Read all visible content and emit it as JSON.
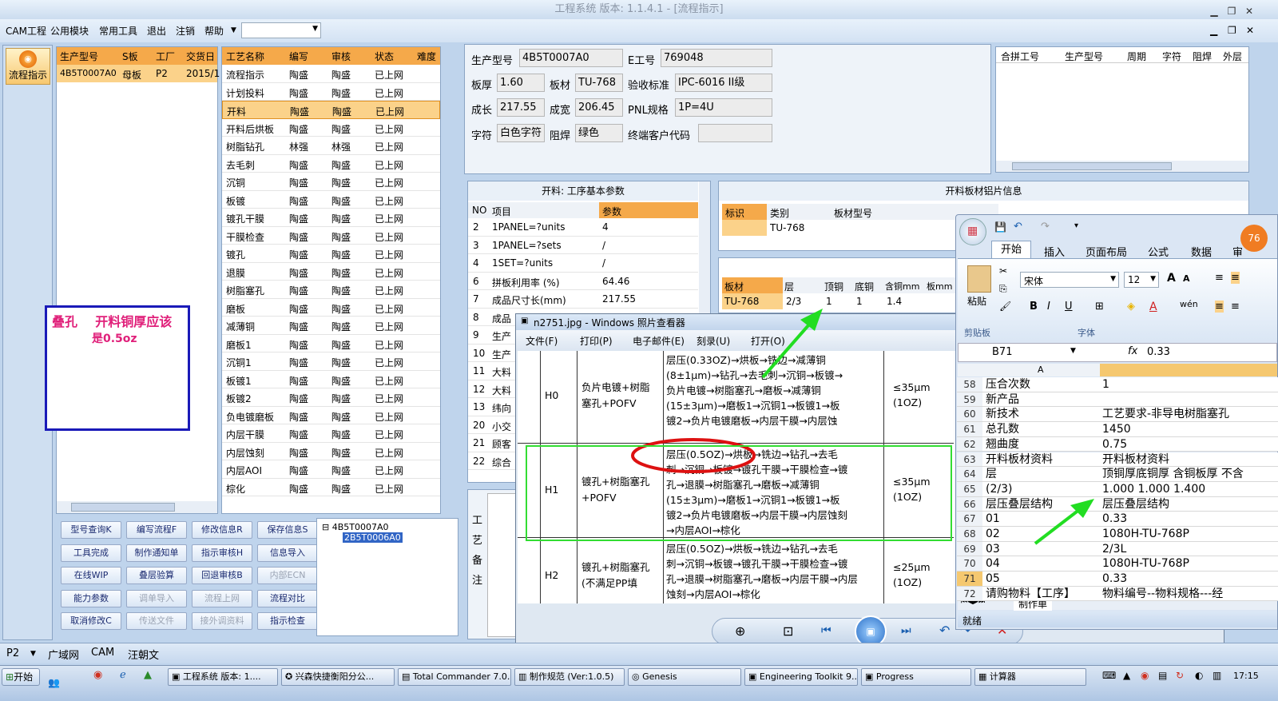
{
  "window": {
    "title": "工程系统  版本: 1.1.4.1 - [流程指示]"
  },
  "menu": {
    "items": [
      "CAM工程",
      "公用模块",
      "常用工具",
      "退出",
      "注销",
      "帮助"
    ]
  },
  "left_nav": {
    "label": "流程指示"
  },
  "job_table": {
    "headers": [
      "生产型号",
      "S板",
      "工厂",
      "交货日"
    ],
    "rows": [
      [
        "4B5T0007A0",
        "母板",
        "P2",
        "2015/1"
      ]
    ]
  },
  "note": {
    "line1": "叠孔    开料铜厚应该",
    "line2": "是0.5oz"
  },
  "process_table": {
    "headers": [
      "工艺名称",
      "编写",
      "审核",
      "状态",
      "难度"
    ],
    "rows": [
      [
        "流程指示",
        "陶盛",
        "陶盛",
        "已上网"
      ],
      [
        "计划投料",
        "陶盛",
        "陶盛",
        "已上网"
      ],
      [
        "开料",
        "陶盛",
        "陶盛",
        "已上网"
      ],
      [
        "开料后烘板",
        "陶盛",
        "陶盛",
        "已上网"
      ],
      [
        "树脂钻孔",
        "林强",
        "林强",
        "已上网"
      ],
      [
        "去毛刺",
        "陶盛",
        "陶盛",
        "已上网"
      ],
      [
        "沉铜",
        "陶盛",
        "陶盛",
        "已上网"
      ],
      [
        "板镀",
        "陶盛",
        "陶盛",
        "已上网"
      ],
      [
        "镀孔干膜",
        "陶盛",
        "陶盛",
        "已上网"
      ],
      [
        "干膜检查",
        "陶盛",
        "陶盛",
        "已上网"
      ],
      [
        "镀孔",
        "陶盛",
        "陶盛",
        "已上网"
      ],
      [
        "退膜",
        "陶盛",
        "陶盛",
        "已上网"
      ],
      [
        "树脂塞孔",
        "陶盛",
        "陶盛",
        "已上网"
      ],
      [
        "磨板",
        "陶盛",
        "陶盛",
        "已上网"
      ],
      [
        "减薄铜",
        "陶盛",
        "陶盛",
        "已上网"
      ],
      [
        "磨板1",
        "陶盛",
        "陶盛",
        "已上网"
      ],
      [
        "沉铜1",
        "陶盛",
        "陶盛",
        "已上网"
      ],
      [
        "板镀1",
        "陶盛",
        "陶盛",
        "已上网"
      ],
      [
        "板镀2",
        "陶盛",
        "陶盛",
        "已上网"
      ],
      [
        "负电镀磨板",
        "陶盛",
        "陶盛",
        "已上网"
      ],
      [
        "内层干膜",
        "陶盛",
        "陶盛",
        "已上网"
      ],
      [
        "内层蚀刻",
        "陶盛",
        "陶盛",
        "已上网"
      ],
      [
        "内层AOI",
        "陶盛",
        "陶盛",
        "已上网"
      ],
      [
        "棕化",
        "陶盛",
        "陶盛",
        "已上网"
      ]
    ]
  },
  "buttons": [
    [
      "型号查询K",
      "编写流程F",
      "修改信息R",
      "保存信息S"
    ],
    [
      "工具完成",
      "制作通知单",
      "指示审核H",
      "信息导入"
    ],
    [
      "在线WIP",
      "叠层验算",
      "回退审核B",
      "内部ECN"
    ],
    [
      "能力参数",
      "调单导入",
      "流程上网",
      "流程对比"
    ],
    [
      "取消修改C",
      "传送文件",
      "接外调资料",
      "指示检查"
    ]
  ],
  "tree": {
    "root": "4B5T0007A0",
    "child": "2B5T0006A0"
  },
  "info": {
    "model_label": "生产型号",
    "model": "4B5T0007A0",
    "e_label": "E工号",
    "e_no": "769048",
    "thick_label": "板厚",
    "thick": "1.60",
    "mat_label": "板材",
    "mat": "TU-768",
    "std_label": "验收标准",
    "std": "IPC-6016 II级",
    "len_label": "成长",
    "len": "217.55",
    "wid_label": "成宽",
    "wid": "206.45",
    "pnl_label": "PNL规格",
    "pnl": "1P=4U",
    "char_label": "字符",
    "char": "白色字符",
    "solder_label": "阻焊",
    "solder": "绿色",
    "cust_label": "终端客户代码"
  },
  "merge_table": {
    "headers": [
      "合拼工号",
      "生产型号",
      "周期",
      "字符",
      "阻焊",
      "外层"
    ]
  },
  "params": {
    "title": "开料: 工序基本参数",
    "headers": [
      "NO",
      "项目",
      "参数"
    ],
    "rows": [
      [
        "2",
        "1PANEL=?units",
        "4"
      ],
      [
        "3",
        "1PANEL=?sets",
        "/"
      ],
      [
        "4",
        "1SET=?units",
        "/"
      ],
      [
        "6",
        "拼板利用率 (%)",
        "64.46"
      ],
      [
        "7",
        "成品尺寸长(mm)",
        "217.55"
      ],
      [
        "8",
        "成品",
        ""
      ],
      [
        "9",
        "生产",
        ""
      ],
      [
        "10",
        "生产",
        ""
      ],
      [
        "11",
        "大料",
        ""
      ],
      [
        "12",
        "大料",
        ""
      ],
      [
        "13",
        "纬向",
        ""
      ],
      [
        "20",
        "小交",
        ""
      ],
      [
        "21",
        "顾客",
        ""
      ],
      [
        "22",
        "综合"
      ]
    ]
  },
  "sheet_info": {
    "title": "开料板材铝片信息",
    "headers": [
      "标识",
      "类别",
      "板材型号"
    ],
    "row": [
      "",
      "TU-768",
      ""
    ],
    "headers2": [
      "板材",
      "层",
      "顶铜",
      "底铜",
      "含铜mm",
      "板mm"
    ],
    "row2": [
      "TU-768",
      "2/3",
      "1",
      "1",
      "1.4",
      ""
    ]
  },
  "remarks": {
    "label": "工艺备注"
  },
  "photo": {
    "title": "n2751.jpg - Windows 照片查看器",
    "menu": [
      "文件(F)",
      "打印(P)",
      "电子邮件(E)",
      "刻录(U)",
      "打开(O)"
    ],
    "rows": [
      {
        "code": "H0",
        "name": [
          "负片电镀+树脂",
          "塞孔+POFV"
        ],
        "flow": [
          "层压(0.33OZ)→烘板→铣边→减薄铜",
          "(8±1μm)→钻孔→去毛刺→沉铜→板镀→",
          "负片电镀→树脂塞孔→磨板→减薄铜",
          "(15±3μm)→磨板1→沉铜1→板镀1→板",
          "镀2→负片电镀磨板→内层干膜→内层蚀"
        ],
        "spec": [
          "≤35μm",
          "(1OZ)"
        ]
      },
      {
        "code": "H1",
        "name": [
          "镀孔+树脂塞孔",
          "+POFV"
        ],
        "flow": [
          "层压(0.5OZ)→烘板→铣边→钻孔→去毛",
          "刺→沉铜→板镀→镀孔干膜→干膜检查→镀",
          "孔→退膜→树脂塞孔→磨板→减薄铜",
          "(15±3μm)→磨板1→沉铜1→板镀1→板",
          "镀2→负片电镀磨板→内层干膜→内层蚀刻",
          "→内层AOI→棕化"
        ],
        "spec": [
          "≤35μm",
          "(1OZ)"
        ]
      },
      {
        "code": "H2",
        "name": [
          "镀孔+树脂塞孔",
          "(不满足PP填"
        ],
        "flow": [
          "层压(0.5OZ)→烘板→铣边→钻孔→去毛",
          "刺→沉铜→板镀→镀孔干膜→干膜检查→镀",
          "孔→退膜→树脂塞孔→磨板→内层干膜→内层",
          "蚀刻→内层AOI→棕化"
        ],
        "spec": [
          "≤25μm",
          "(1OZ)"
        ]
      }
    ]
  },
  "excel": {
    "tabs": [
      "开始",
      "插入",
      "页面布局",
      "公式",
      "数据",
      "审"
    ],
    "font": "宋体",
    "size": "12",
    "paste": "粘贴",
    "clipboard": "剪贴板",
    "font_group": "字体",
    "cell_ref": "B71",
    "formula": "0.33",
    "col_a": "A",
    "rows": [
      [
        "58",
        "压合次数",
        "1"
      ],
      [
        "59",
        "新产品",
        ""
      ],
      [
        "60",
        "新技术",
        "工艺要求-非导电树脂塞孔"
      ],
      [
        "61",
        "总孔数",
        "1450"
      ],
      [
        "62",
        "翘曲度",
        "0.75"
      ],
      [
        "63",
        "开料板材资料",
        "开料板材资料"
      ],
      [
        "64",
        "层",
        "顶铜厚底铜厚  含铜板厚  不含"
      ],
      [
        "65",
        "(2/3)",
        "1.000   1.000   1.400"
      ],
      [
        "66",
        "层压叠层结构",
        "层压叠层结构"
      ],
      [
        "67",
        "01",
        "0.33"
      ],
      [
        "68",
        "02",
        "1080H-TU-768P"
      ],
      [
        "69",
        "03",
        "2/3L"
      ],
      [
        "70",
        "04",
        "1080H-TU-768P"
      ],
      [
        "71",
        "05",
        "0.33"
      ],
      [
        "72",
        "请购物料【工序】",
        "物料编号--物料规格---经"
      ]
    ],
    "sheet_tab": "制作单",
    "status": "就绪",
    "badge": "76"
  },
  "status": {
    "p2": "P2",
    "items": [
      "广域网",
      "CAM",
      "汪朝文"
    ]
  },
  "taskbar": {
    "start": "开始",
    "tasks": [
      "工程系统  版本: 1....",
      "兴森快捷衡阳分公...",
      "Total Commander 7.0...",
      "制作规范 (Ver:1.0.5)",
      "Genesis",
      "Engineering Toolkit 9....",
      "Progress",
      "计算器"
    ],
    "clock": "17:15"
  },
  "colors": {
    "header": "#f5a94a",
    "selected": "#fbd28a",
    "note_border": "#1a1ab8",
    "note_text": "#e0207a",
    "arrow": "#22dd22",
    "circle": "#dd1111"
  }
}
